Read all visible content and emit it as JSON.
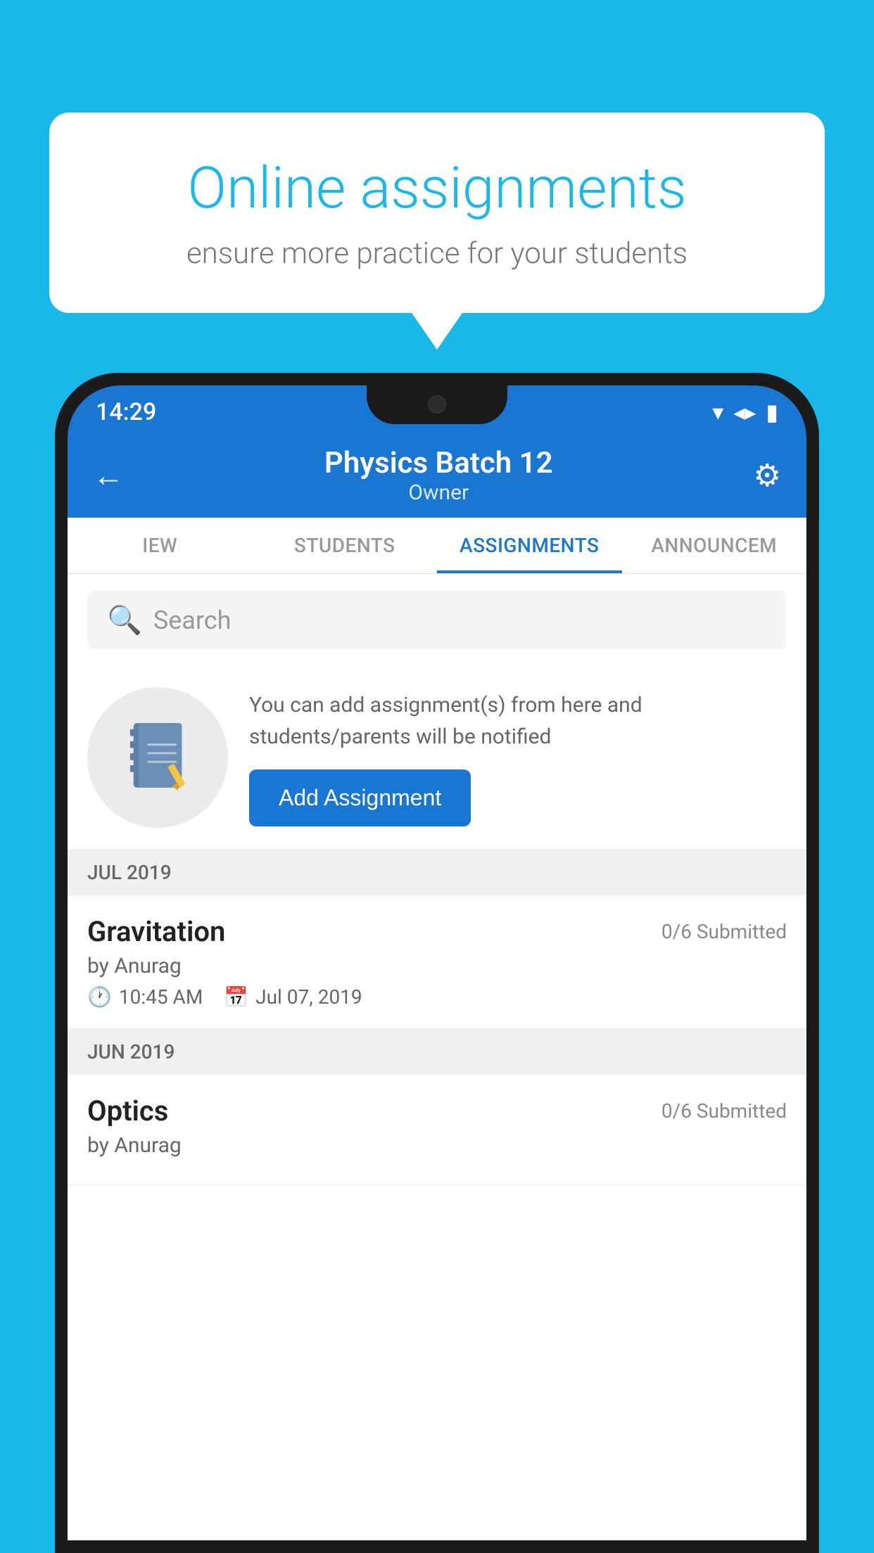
{
  "background_color": "#1ab8e8",
  "speech_bubble": {
    "title": "Online assignments",
    "subtitle": "ensure more practice for your students"
  },
  "status_bar": {
    "time": "14:29",
    "wifi": "▾",
    "signal": "▲",
    "battery": "▮"
  },
  "app_bar": {
    "title": "Physics Batch 12",
    "subtitle": "Owner",
    "back_label": "←",
    "settings_label": "⚙"
  },
  "tabs": [
    {
      "label": "IEW",
      "active": false
    },
    {
      "label": "STUDENTS",
      "active": false
    },
    {
      "label": "ASSIGNMENTS",
      "active": true
    },
    {
      "label": "ANNOUNCEM",
      "active": false
    }
  ],
  "search": {
    "placeholder": "Search"
  },
  "empty_state": {
    "description": "You can add assignment(s) from here and students/parents will be notified",
    "button_label": "Add Assignment"
  },
  "sections": [
    {
      "header": "JUL 2019",
      "assignments": [
        {
          "title": "Gravitation",
          "submitted": "0/6 Submitted",
          "author": "by Anurag",
          "time": "10:45 AM",
          "date": "Jul 07, 2019"
        }
      ]
    },
    {
      "header": "JUN 2019",
      "assignments": [
        {
          "title": "Optics",
          "submitted": "0/6 Submitted",
          "author": "by Anurag",
          "time": "",
          "date": ""
        }
      ]
    }
  ]
}
